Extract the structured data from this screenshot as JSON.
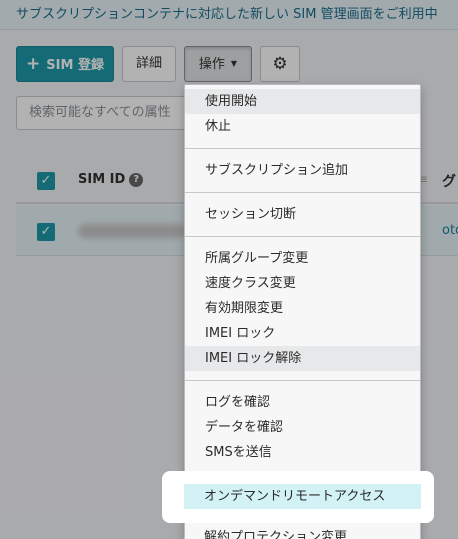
{
  "banner": {
    "text": "サブスクリプションコンテナに対応した新しい SIM 管理画面をご利用中"
  },
  "toolbar": {
    "register_label": "SIM 登録",
    "detail_label": "詳細",
    "operations_label": "操作",
    "settings_icon": "gear-icon"
  },
  "search": {
    "placeholder": "検索可能なすべての属性"
  },
  "table": {
    "headers": {
      "sim_id": "SIM ID",
      "group": "グ"
    },
    "rows": [
      {
        "checked": true,
        "group_link": "oto"
      }
    ]
  },
  "menu": {
    "sections": [
      [
        "使用開始",
        "休止"
      ],
      [
        "サブスクリプション追加"
      ],
      [
        "セッション切断"
      ],
      [
        "所属グループ変更",
        "速度クラス変更",
        "有効期限変更",
        "IMEI ロック",
        "IMEI ロック解除"
      ],
      [
        "ログを確認",
        "データを確認",
        "SMSを送信"
      ],
      [
        "オンデマンドリモートアクセス"
      ],
      [
        "解約プロテクション変更"
      ]
    ],
    "highlighted_item": "オンデマンドリモートアクセス"
  },
  "colors": {
    "primary": "#1f9aa8",
    "highlight": "#d3f2f6",
    "banner_text": "#1b6d8c"
  }
}
